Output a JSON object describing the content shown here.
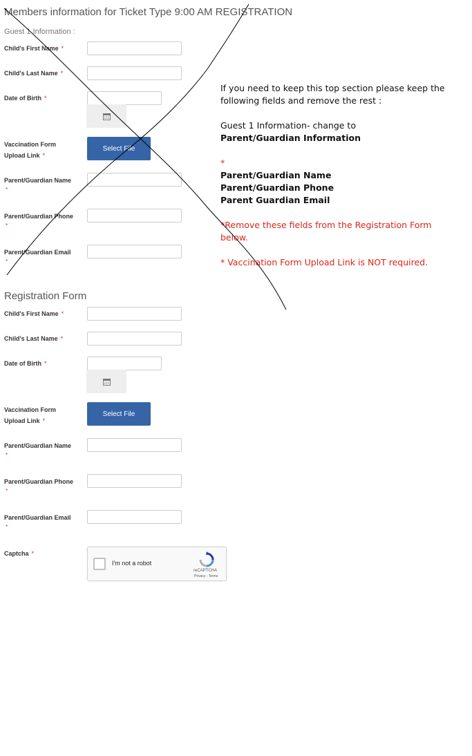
{
  "top_section": {
    "title": "Members information for Ticket Type 9:00 AM REGISTRATION",
    "subtitle": "Guest 1 Information :",
    "fields": {
      "first_name": "Child's First Name",
      "last_name": "Child's Last Name",
      "dob": "Date of Birth",
      "vacc_line1": "Vaccination Form",
      "vacc_line2": "Upload Link",
      "guardian_name": "Parent/Guardian Name",
      "guardian_phone": "Parent/Guardian Phone",
      "guardian_email": "Parent/Guardian Email"
    },
    "select_file_label": "Select File"
  },
  "registration_form": {
    "title": "Registration Form",
    "fields": {
      "first_name": "Child's First Name",
      "last_name": "Child's Last Name",
      "dob": "Date of Birth",
      "vacc_line1": "Vaccination Form",
      "vacc_line2": "Upload Link",
      "guardian_name": "Parent/Guardian Name",
      "guardian_phone": "Parent/Guardian Phone",
      "guardian_email": "Parent/Guardian Email",
      "captcha": "Captcha"
    },
    "select_file_label": "Select File"
  },
  "required_marker": "*",
  "recaptcha": {
    "checkbox_label": "I'm not a robot",
    "brand": "reCAPTCHA",
    "terms": "Privacy - Terms"
  },
  "annotation": {
    "line1": "If you need to keep this top section please keep the",
    "line2": "following fields and remove the rest :",
    "line3": "Guest 1 Information- change to",
    "line4": "Parent/Guardian Information",
    "asterisk": "*",
    "keep1": "Parent/Guardian Name",
    "keep2": "Parent/Guardian Phone",
    "keep3": "Parent Guardian Email",
    "remove1": "*Remove these fields from the Registration Form",
    "remove2": "below.",
    "vacc_note": "* Vaccination Form Upload Link is NOT required."
  },
  "colors": {
    "required": "#d32f2f",
    "button": "#3565a6",
    "annotation_red": "#d9261c"
  }
}
